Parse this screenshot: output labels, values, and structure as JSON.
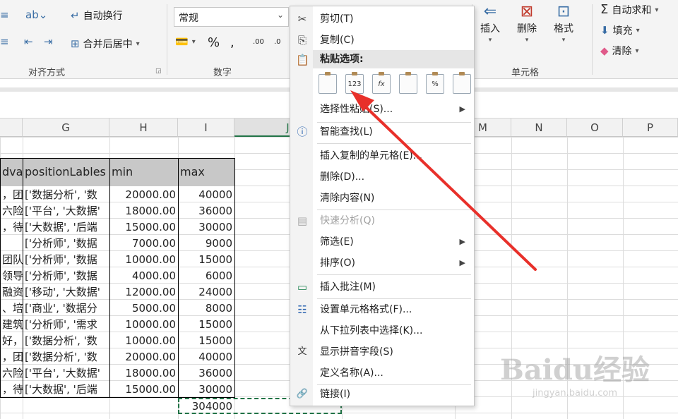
{
  "ribbon": {
    "alignment": {
      "wrap_text": "自动换行",
      "merge_center": "合并后居中",
      "group_label": "对齐方式"
    },
    "number": {
      "format_value": "常规",
      "percent": "%",
      "comma": ",",
      "inc_decimal": ".00",
      "dec_decimal": ".0",
      "group_label": "数字"
    },
    "cells": {
      "insert": "插入",
      "delete": "删除",
      "format": "格式",
      "group_label": "单元格"
    },
    "editing": {
      "autosum": "自动求和",
      "fill": "填充",
      "clear": "清除"
    }
  },
  "columns": [
    "G",
    "H",
    "I",
    "J",
    "M",
    "N",
    "O",
    "P"
  ],
  "table": {
    "headers": [
      "dvar",
      "positionLables",
      "min",
      "max"
    ],
    "rows": [
      [
        "，团",
        "['数据分析', '数",
        "20000.00",
        "40000"
      ],
      [
        "六险",
        "['平台', '大数据'",
        "18000.00",
        "36000"
      ],
      [
        "，待",
        "['大数据', '后端",
        "15000.00",
        "30000"
      ],
      [
        "",
        "['分析师', '数据",
        "7000.00",
        "9000"
      ],
      [
        "团队",
        "['分析师', '数据",
        "10000.00",
        "15000"
      ],
      [
        "领导",
        "['分析师', '数据",
        "4000.00",
        "6000"
      ],
      [
        "融资",
        "['移动', '大数据'",
        "12000.00",
        "24000"
      ],
      [
        "、培",
        "['商业', '数据分",
        "5000.00",
        "8000"
      ],
      [
        "建筑",
        "['分析师', '需求",
        "10000.00",
        "15000"
      ],
      [
        "好，",
        "['数据分析', '数",
        "10000.00",
        "15000"
      ],
      [
        "，团",
        "['数据分析', '数",
        "20000.00",
        "40000"
      ],
      [
        "六险",
        "['平台', '大数据'",
        "18000.00",
        "36000"
      ],
      [
        "，待",
        "['大数据', '后端",
        "15000.00",
        "30000"
      ]
    ],
    "total": "304000"
  },
  "context_menu": {
    "items": [
      {
        "label": "剪切(T)",
        "icon": "scissors-icon",
        "glyph": "✂"
      },
      {
        "label": "复制(C)",
        "icon": "copy-icon",
        "glyph": "⎘"
      },
      {
        "label": "粘贴选项:",
        "icon": "paste-icon",
        "glyph": "📋"
      },
      {
        "label": "选择性粘贴(S)...",
        "icon": "",
        "glyph": ""
      },
      {
        "label": "智能查找(L)",
        "icon": "smart-lookup-icon",
        "glyph": "ⓘ"
      },
      {
        "label": "插入复制的单元格(E)...",
        "icon": "",
        "glyph": ""
      },
      {
        "label": "删除(D)...",
        "icon": "",
        "glyph": ""
      },
      {
        "label": "清除内容(N)",
        "icon": "",
        "glyph": ""
      },
      {
        "label": "快速分析(Q)",
        "icon": "quick-analysis-icon",
        "glyph": "▤"
      },
      {
        "label": "筛选(E)",
        "icon": "",
        "glyph": ""
      },
      {
        "label": "排序(O)",
        "icon": "",
        "glyph": ""
      },
      {
        "label": "插入批注(M)",
        "icon": "comment-icon",
        "glyph": "▭"
      },
      {
        "label": "设置单元格格式(F)...",
        "icon": "format-cells-icon",
        "glyph": "☷"
      },
      {
        "label": "从下拉列表中选择(K)...",
        "icon": "",
        "glyph": ""
      },
      {
        "label": "显示拼音字段(S)",
        "icon": "pinyin-icon",
        "glyph": "文"
      },
      {
        "label": "定义名称(A)...",
        "icon": "",
        "glyph": ""
      },
      {
        "label": "链接(I)",
        "icon": "link-icon",
        "glyph": "🔗"
      }
    ],
    "paste_options": [
      "",
      "123",
      "fx",
      "",
      "%",
      ""
    ]
  },
  "watermark": {
    "main": "Baidu经验",
    "sub": "jingyan.baidu.com"
  },
  "colors": {
    "accent_green": "#217346",
    "arrow_red": "#e8302a",
    "header_grey": "#c8c8c8"
  }
}
